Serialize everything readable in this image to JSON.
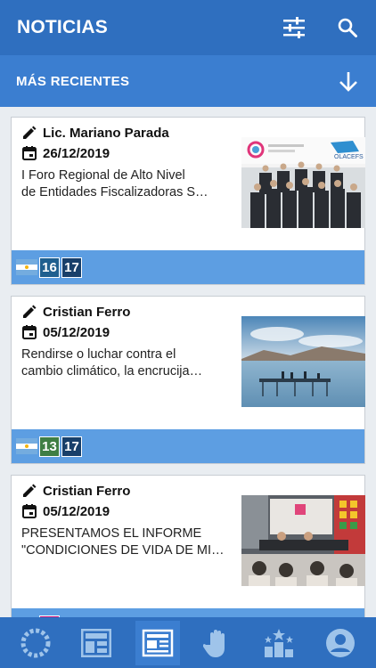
{
  "app": {
    "title": "NOTICIAS",
    "actions": [
      "filter-icon",
      "search-icon"
    ]
  },
  "section": {
    "label": "MÁS RECIENTES",
    "sort_icon": "arrow-down-icon"
  },
  "articles": [
    {
      "author": "Lic. Mariano Parada",
      "date": "26/12/2019",
      "headline_line1": "I Foro Regional de Alto Nivel",
      "headline_line2": "de Entidades Fiscalizadoras S…",
      "thumb_logo_text": "OLACEFS",
      "ods": [
        {
          "number": "16",
          "color": "#1f5f8f"
        },
        {
          "number": "17",
          "color": "#183f6a"
        }
      ]
    },
    {
      "author": "Cristian Ferro",
      "date": "05/12/2019",
      "headline_line1": "Rendirse o luchar contra el",
      "headline_line2": "cambio climático, la encrucija…",
      "ods": [
        {
          "number": "13",
          "color": "#3f7e44"
        },
        {
          "number": "17",
          "color": "#183f6a"
        }
      ]
    },
    {
      "author": "Cristian Ferro",
      "date": "05/12/2019",
      "headline_line1": "PRESENTAMOS EL INFORME",
      "headline_line2": "\"CONDICIONES DE VIDA DE MI…",
      "ods": []
    }
  ],
  "bottom_nav": [
    {
      "icon": "ods-wheel-icon",
      "active": false
    },
    {
      "icon": "dashboard-icon",
      "active": false
    },
    {
      "icon": "newspaper-icon",
      "active": true
    },
    {
      "icon": "hand-icon",
      "active": false
    },
    {
      "icon": "ranking-icon",
      "active": false
    },
    {
      "icon": "account-icon",
      "active": false
    }
  ],
  "colors": {
    "app_bar": "#2f6fbf",
    "section_bar": "#3b7ed0",
    "card_footer": "#5d9ee2",
    "background": "#e9edf1"
  }
}
